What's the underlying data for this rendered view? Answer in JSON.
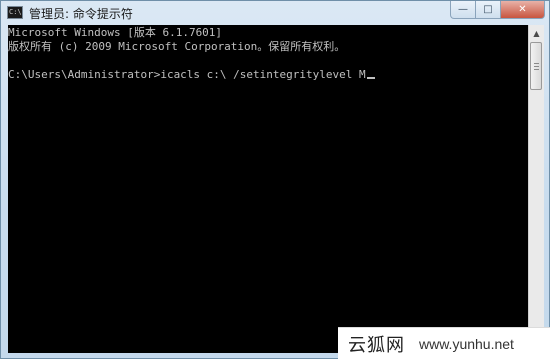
{
  "window": {
    "title": "管理员: 命令提示符",
    "icon_text": "C:\\",
    "buttons": {
      "minimize": "—",
      "maximize": "□",
      "close": "✕"
    }
  },
  "console": {
    "lines": [
      "Microsoft Windows [版本 6.1.7601]",
      "版权所有 (c) 2009 Microsoft Corporation。保留所有权利。",
      "",
      "C:\\Users\\Administrator>icacls c:\\ /setintegritylevel M"
    ],
    "text_color": "#c0c0c0",
    "background": "#000000"
  },
  "scrollbar": {
    "up_icon": "▲",
    "down_icon": "▼"
  },
  "watermark": {
    "logo": "云狐网",
    "url": "www.yunhu.net"
  }
}
